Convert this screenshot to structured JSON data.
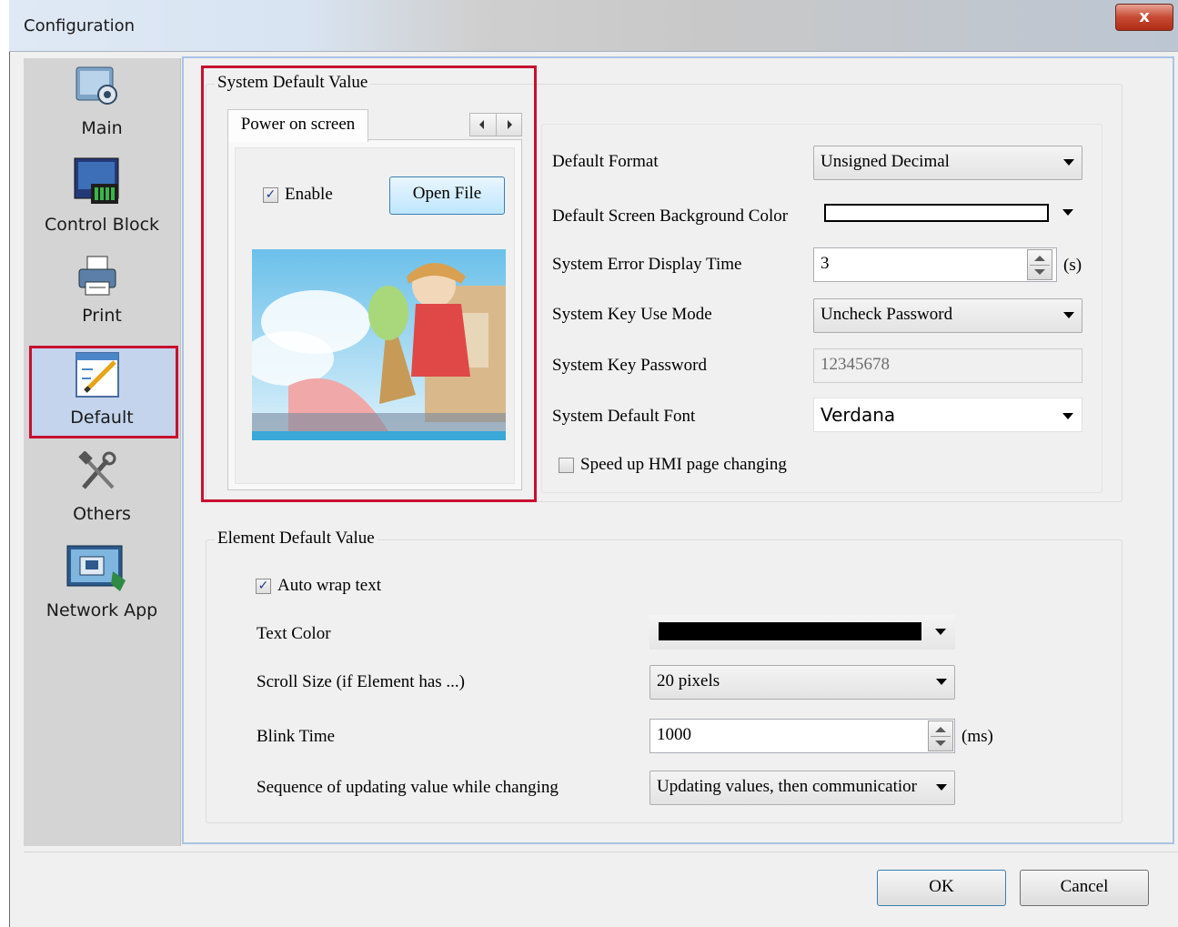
{
  "window": {
    "title": "Configuration",
    "close_glyph": "x"
  },
  "sidebar": {
    "items": [
      {
        "label": "Main",
        "icon": "main-settings-icon"
      },
      {
        "label": "Control Block",
        "icon": "control-block-icon"
      },
      {
        "label": "Print",
        "icon": "printer-icon"
      },
      {
        "label": "Default",
        "icon": "default-edit-icon",
        "selected": true
      },
      {
        "label": "Others",
        "icon": "tools-icon"
      },
      {
        "label": "Network App",
        "icon": "network-app-icon"
      }
    ]
  },
  "system_default": {
    "group_title": "System Default Value",
    "power_on": {
      "tab_label": "Power on screen",
      "enable_label": "Enable",
      "enable_checked": true,
      "open_file_label": "Open File",
      "preview_image": "anime-girl-ice-cream-image"
    },
    "fields": {
      "default_format_label": "Default Format",
      "default_format_value": "Unsigned Decimal",
      "bg_color_label": "Default Screen Background Color",
      "bg_color_value": "#ffffff",
      "error_time_label": "System Error Display Time",
      "error_time_value": "3",
      "error_time_unit": "(s)",
      "key_mode_label": "System Key Use Mode",
      "key_mode_value": "Uncheck Password",
      "key_password_label": "System Key Password",
      "key_password_value": "12345678",
      "font_label": "System Default Font",
      "font_value": "Verdana",
      "speed_up_label": "Speed up HMI page changing",
      "speed_up_checked": false
    }
  },
  "element_default": {
    "group_title": "Element Default Value",
    "auto_wrap_label": "Auto wrap text",
    "auto_wrap_checked": true,
    "text_color_label": "Text Color",
    "text_color_value": "#000000",
    "scroll_size_label": "Scroll Size (if Element has ...)",
    "scroll_size_value": "20 pixels",
    "blink_time_label": "Blink Time",
    "blink_time_value": "1000",
    "blink_time_unit": "(ms)",
    "sequence_label": "Sequence of updating value while changing",
    "sequence_value": "Updating values, then communicatior"
  },
  "footer": {
    "ok_label": "OK",
    "cancel_label": "Cancel"
  },
  "colors": {
    "highlight": "#c8102e",
    "selected_bg": "#c3d4ec",
    "panel_border": "#a8c4e4"
  }
}
